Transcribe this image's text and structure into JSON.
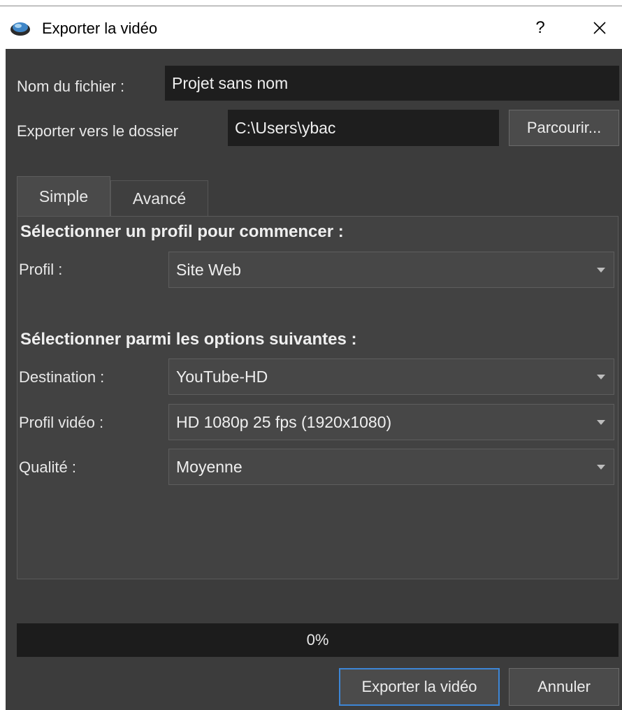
{
  "window": {
    "title": "Exporter la vidéo",
    "help_label": "?",
    "icon": "app-logo-icon",
    "close_icon": "close-icon"
  },
  "file": {
    "name_label": "Nom du fichier :",
    "name_value": "Projet sans nom",
    "folder_label": "Exporter vers le dossier",
    "folder_value": "C:\\Users\\ybac",
    "browse_label": "Parcourir..."
  },
  "tabs": [
    {
      "label": "Simple",
      "active": true
    },
    {
      "label": "Avancé",
      "active": false
    }
  ],
  "simple": {
    "profile_heading": "Sélectionner un profil pour commencer :",
    "profile_label": "Profil :",
    "profile_value": "Site Web",
    "options_heading": "Sélectionner parmi les options suivantes :",
    "destination_label": "Destination :",
    "destination_value": "YouTube-HD",
    "video_profile_label": "Profil vidéo :",
    "video_profile_value": "HD 1080p 25 fps (1920x1080)",
    "quality_label": "Qualité :",
    "quality_value": "Moyenne"
  },
  "progress": {
    "value": 0,
    "text": "0%"
  },
  "buttons": {
    "export_label": "Exporter la vidéo",
    "cancel_label": "Annuler"
  },
  "colors": {
    "dialog_bg": "#3c3c3c",
    "field_bg": "#1e1e1e",
    "accent": "#3d86d6"
  }
}
